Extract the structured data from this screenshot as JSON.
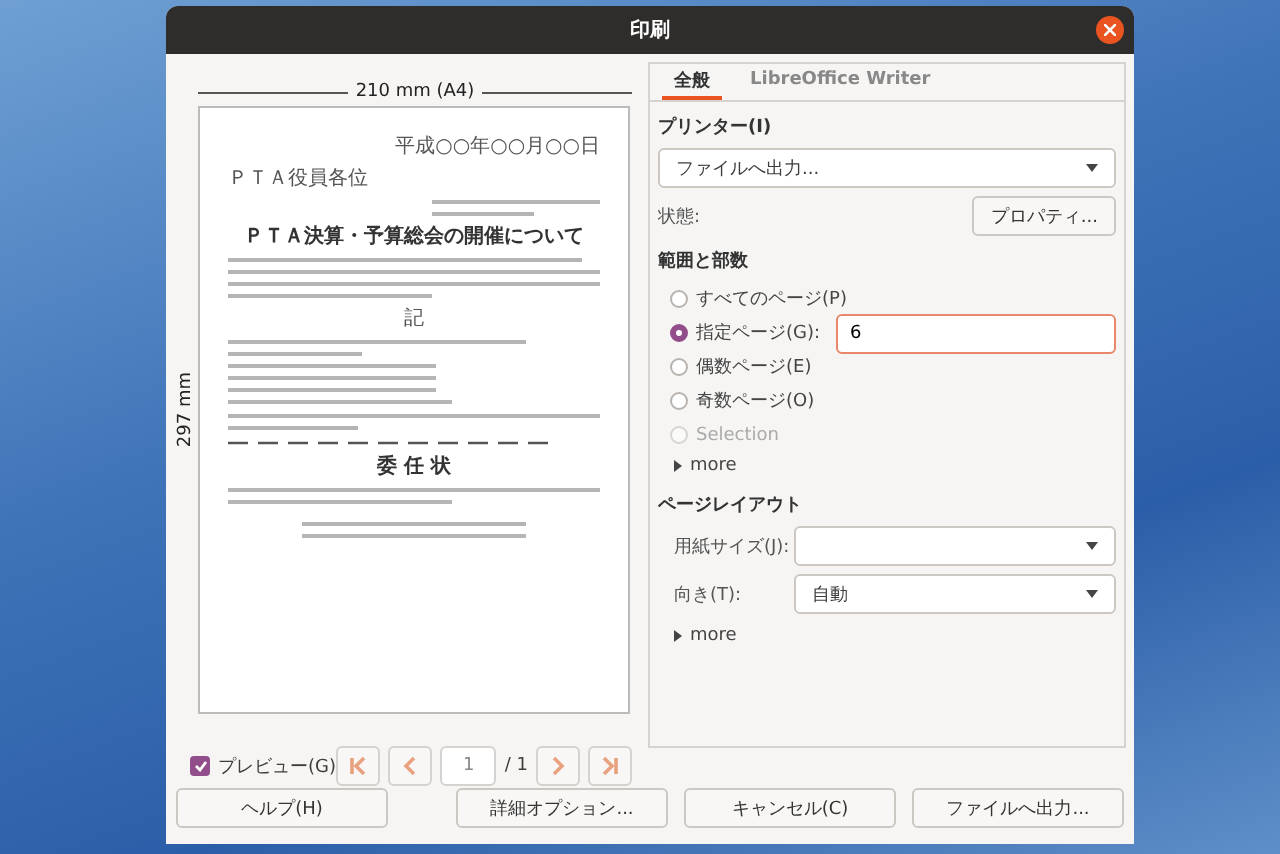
{
  "window": {
    "title": "印刷"
  },
  "preview": {
    "width_label": "210 mm (A4)",
    "height_label": "297 mm",
    "page": {
      "date": "平成○○年○○月○○日",
      "addressee": "ＰＴＡ役員各位",
      "title": "ＰＴＡ決算・予算総会の開催について",
      "note_heading": "記",
      "proxy_heading": "委 任 状"
    },
    "show_preview": {
      "label": "プレビュー(G)",
      "checked": true
    },
    "pager": {
      "page": "1",
      "total": "/ 1"
    }
  },
  "tabs": [
    {
      "label": "全般",
      "selected": true
    },
    {
      "label": "LibreOffice Writer",
      "selected": false
    }
  ],
  "printer": {
    "heading": "プリンター(I)",
    "value": "ファイルへ出力...",
    "status_label": "状態:",
    "properties_button": "プロパティ..."
  },
  "range": {
    "heading": "範囲と部数",
    "options": [
      {
        "label": "すべてのページ(P)",
        "selected": false,
        "disabled": false
      },
      {
        "label": "指定ページ(G):",
        "selected": true,
        "disabled": false,
        "value": "6"
      },
      {
        "label": "偶数ページ(E)",
        "selected": false,
        "disabled": false
      },
      {
        "label": "奇数ページ(O)",
        "selected": false,
        "disabled": false
      },
      {
        "label": "Selection",
        "selected": false,
        "disabled": true
      }
    ],
    "more": "more"
  },
  "layout": {
    "heading": "ページレイアウト",
    "fields": [
      {
        "label": "用紙サイズ(J):"
      },
      {
        "label": "向き(T):",
        "value": "自動"
      }
    ],
    "more": "more"
  },
  "buttons": [
    "ヘルプ(H)",
    "詳細オプション...",
    "キャンセル(C)",
    "ファイルへ出力..."
  ]
}
